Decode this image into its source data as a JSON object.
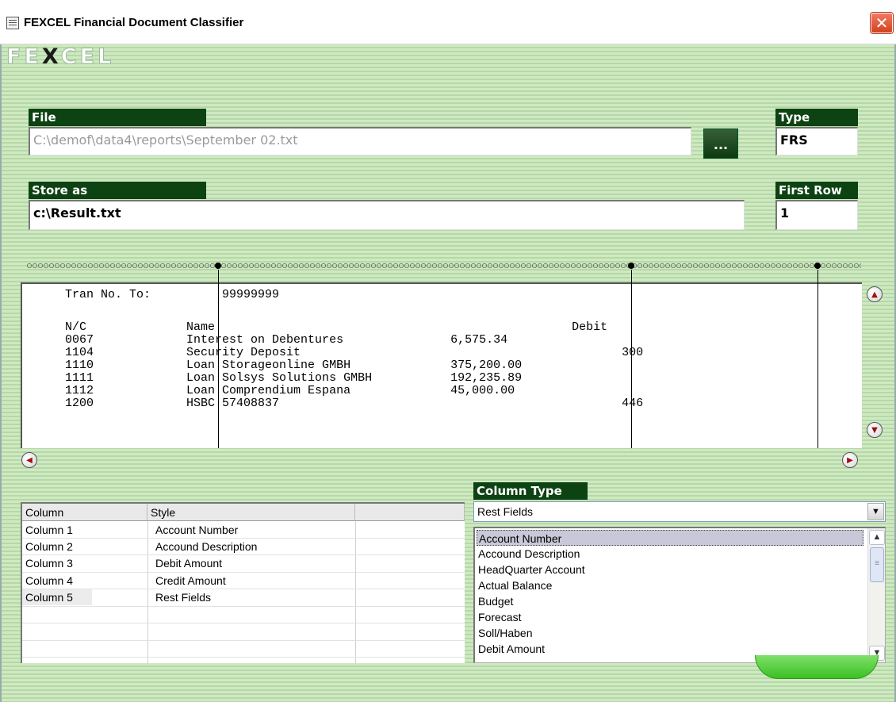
{
  "window": {
    "title": "FEXCEL Financial Document Classifier",
    "close_glyph": "✕",
    "logo": "FEXCEL"
  },
  "file": {
    "label": "File",
    "value": "C:\\demof\\data4\\reports\\September 02.txt",
    "browse_label": "..."
  },
  "type": {
    "label": "Type",
    "value": "FRS"
  },
  "store": {
    "label": "Store as",
    "value": "c:\\Result.txt"
  },
  "first_row": {
    "label": "First Row",
    "value": "1"
  },
  "preview": {
    "lines": [
      "      Tran No. To:          99999999",
      "",
      "      N/C              Name                                                  Debit",
      "      0067             Interest on Debentures               6,575.34",
      "      1104             Security Deposit                                             300",
      "      1110             Loan Storageonline GMBH              375,200.00",
      "      1111             Loan Solsys Solutions GMBH           192,235.89",
      "      1112             Loan Comprendium Espana              45,000.00",
      "      1200             HSBC 57408837                                                446"
    ]
  },
  "grid": {
    "headers": [
      "Column",
      "Style",
      ""
    ],
    "rows": [
      [
        "Column 1",
        "Account Number"
      ],
      [
        "Column 2",
        "Accound Description"
      ],
      [
        "Column 3",
        "Debit Amount"
      ],
      [
        "Column 4",
        "Credit Amount"
      ],
      [
        "Column 5",
        "Rest Fields"
      ]
    ]
  },
  "column_type": {
    "label": "Column Type",
    "selected": "Rest Fields",
    "options": [
      "Account Number",
      "Accound Description",
      "HeadQuarter Account",
      "Actual Balance",
      "Budget",
      "Forecast",
      "Soll/Haben",
      "Debit Amount"
    ]
  },
  "icons": {
    "up": "▲",
    "down": "▼",
    "left": "◀",
    "right": "▶",
    "grip": "≡"
  }
}
